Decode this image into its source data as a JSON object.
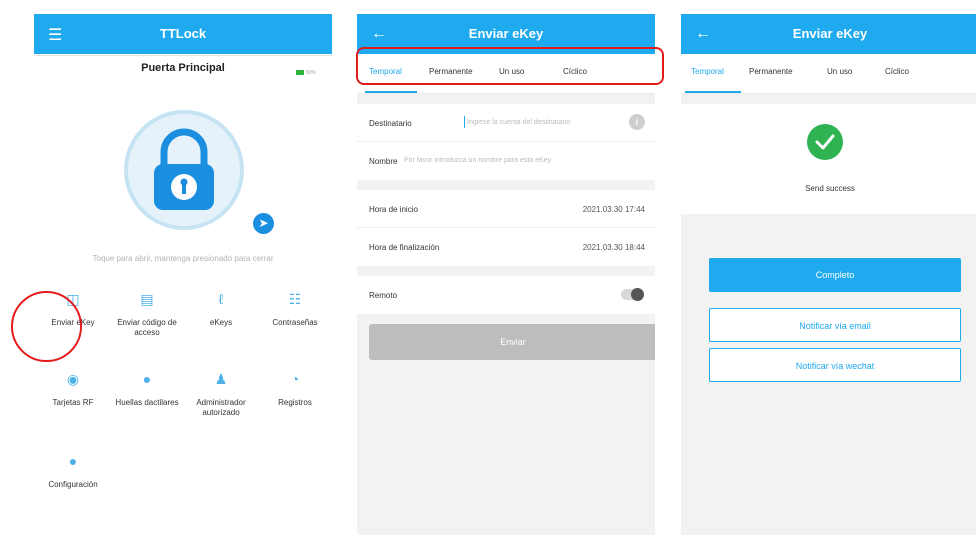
{
  "screen1": {
    "app_title": "TTLock",
    "lock_name": "Puerta Principal",
    "battery": "80%",
    "hint": "Toque para abrir, mantenga presionado para cerrar",
    "menu": [
      {
        "label": "Enviar eKey",
        "icon": "ekey-icon"
      },
      {
        "label": "Enviar código de acceso",
        "icon": "passcode-icon"
      },
      {
        "label": "eKeys",
        "icon": "ekeys-icon"
      },
      {
        "label": "Contraseñas",
        "icon": "passwords-icon"
      },
      {
        "label": "Tarjetas RF",
        "icon": "card-icon"
      },
      {
        "label": "Huellas dactilares",
        "icon": "fingerprint-icon"
      },
      {
        "label": "Administrador autorizado",
        "icon": "admin-icon"
      },
      {
        "label": "Registros",
        "icon": "records-icon"
      },
      {
        "label": "Configuración",
        "icon": "settings-icon"
      }
    ]
  },
  "screen2": {
    "title": "Enviar eKey",
    "tabs": [
      "Temporal",
      "Permanente",
      "Un uso",
      "Cíclico"
    ],
    "recipient_label": "Destinatario",
    "recipient_placeholder": "Ingrese la cuenta del destinatario",
    "name_label": "Nombre",
    "name_placeholder": "Por favor introduzca un nombre para esta eKey",
    "start_label": "Hora de inicio",
    "start_value": "2021.03.30 17:44",
    "end_label": "Hora de finalización",
    "end_value": "2021.03.30 18:44",
    "remote_label": "Remoto",
    "send_label": "Enviar"
  },
  "screen3": {
    "title": "Enviar eKey",
    "tabs": [
      "Temporal",
      "Permanente",
      "Un uso",
      "Cíclico"
    ],
    "success_text": "Send success",
    "complete_label": "Completo",
    "email_label": "Notificar vía email",
    "wechat_label": "Notificar vía wechat"
  },
  "colors": {
    "primary": "#1fa9ee",
    "annotation_red": "#e31b1b",
    "success_green": "#2fb352"
  }
}
